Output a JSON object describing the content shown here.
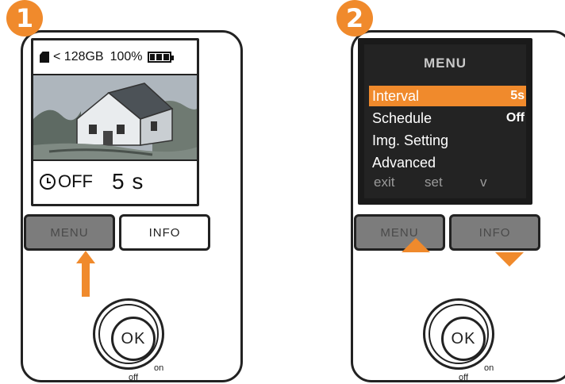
{
  "panels": [
    {
      "step": "1",
      "screen": {
        "storage": "< 128GB",
        "battery": "100%",
        "timer_state": "OFF",
        "timer_value": "5 s"
      },
      "buttons": {
        "menu": "MENU",
        "info": "INFO"
      },
      "ok_label": "OK",
      "switch": {
        "off": "off",
        "on": "on"
      }
    },
    {
      "step": "2",
      "menu": {
        "title": "MENU",
        "items": [
          {
            "label": "Interval",
            "value": "5s"
          },
          {
            "label": "Schedule",
            "value": "Off"
          },
          {
            "label": "Img. Setting",
            "value": ""
          },
          {
            "label": "Advanced",
            "value": ""
          }
        ],
        "footer": [
          "exit",
          "set",
          "v"
        ]
      },
      "buttons": {
        "menu": "MENU",
        "info": "INFO"
      },
      "ok_label": "OK",
      "switch": {
        "off": "off",
        "on": "on"
      }
    }
  ],
  "colors": {
    "accent": "#f08a2c",
    "screen_dark": "#232323",
    "button_pressed": "#7c7c7c"
  },
  "icons": {
    "sd_card": "sd-card-icon",
    "battery": "battery-icon",
    "clock": "clock-icon",
    "arrow_up": "arrow-up-icon",
    "triangle_up": "triangle-up-icon",
    "triangle_down": "triangle-down-icon"
  }
}
